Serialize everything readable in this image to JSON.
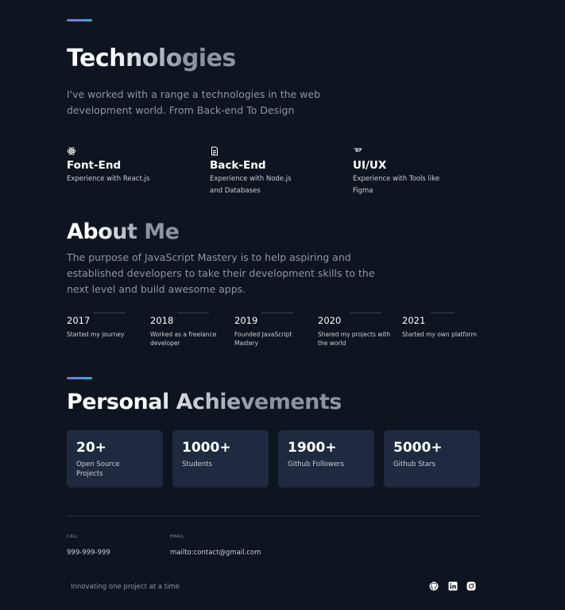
{
  "technologies": {
    "title": "Technologies",
    "intro": "I've worked with a range a technologies in the web development world. From Back-end To Design",
    "items": [
      {
        "icon": "react-icon",
        "title": "Font-End",
        "desc": "Experience with React.js"
      },
      {
        "icon": "document-icon",
        "title": "Back-End",
        "desc": "Experience with Node.js and Databases"
      },
      {
        "icon": "figma-icon",
        "title": "UI/UX",
        "desc": "Experience with Tools like Figma"
      }
    ]
  },
  "about": {
    "title": "About Me",
    "intro": "The purpose of JavaScript Mastery is to help aspiring and established developers to take their development skills to the next level and build awesome apps.",
    "timeline": [
      {
        "year": "2017",
        "desc": "Started my journey"
      },
      {
        "year": "2018",
        "desc": "Worked as a freelance developer"
      },
      {
        "year": "2019",
        "desc": "Founded JavaScript Mastery"
      },
      {
        "year": "2020",
        "desc": "Shared my projects with the world"
      },
      {
        "year": "2021",
        "desc": "Started my own platform"
      }
    ]
  },
  "achievements": {
    "title": "Personal Achievements",
    "cards": [
      {
        "value": "20+",
        "label": "Open Source Projects"
      },
      {
        "value": "1000+",
        "label": "Students"
      },
      {
        "value": "1900+",
        "label": "Github Followers"
      },
      {
        "value": "5000+",
        "label": "Github Stars"
      }
    ]
  },
  "contact": {
    "call_label": "CALL",
    "call_value": "999-999-999",
    "email_label": "EMAIL",
    "email_value": "mailto:contact@gmail.com"
  },
  "footer": {
    "tagline": "Innovating one project at a time",
    "socials": [
      "github-icon",
      "linkedin-icon",
      "instagram-icon"
    ]
  },
  "colors": {
    "background": "#0f1520",
    "card": "#1f2a40",
    "accent_start": "#8a6ce0",
    "accent_end": "#2ab0e0"
  }
}
